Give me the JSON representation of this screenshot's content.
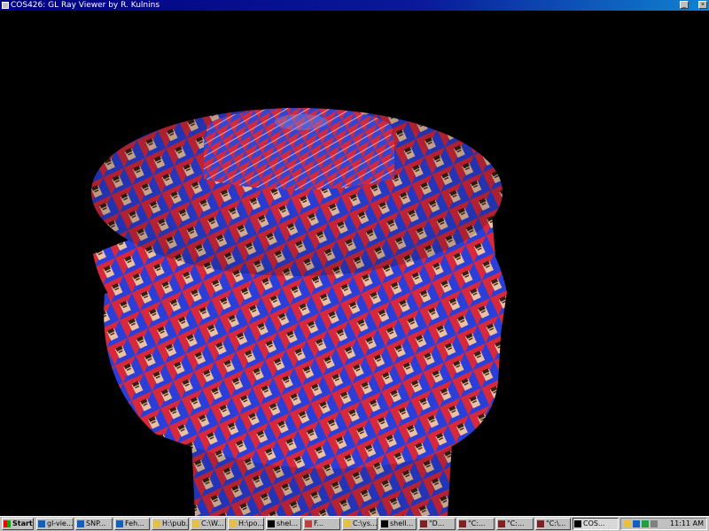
{
  "window": {
    "title": "COS426: GL Ray Viewer by R. Kulnins",
    "minimize_icon": "minimize-icon",
    "close_icon": "close-icon"
  },
  "scene": {
    "description_icon": "textured-3d-model",
    "colors": {
      "red": "#d8283c",
      "blue": "#2b3ed8",
      "background": "#000000"
    }
  },
  "taskbar": {
    "start_label": "Start",
    "buttons": [
      {
        "label": "gl-vie...",
        "icon": "window-icon"
      },
      {
        "label": "SNP...",
        "icon": "window-icon"
      },
      {
        "label": "Feh...",
        "icon": "window-icon"
      },
      {
        "label": "H:\\pub...",
        "icon": "folder-icon"
      },
      {
        "label": "C:\\W...",
        "icon": "folder-icon"
      },
      {
        "label": "H:\\po...",
        "icon": "folder-icon"
      },
      {
        "label": "shel...",
        "icon": "terminal-icon"
      },
      {
        "label": "F...",
        "icon": "app-icon"
      },
      {
        "label": "C:\\ys...",
        "icon": "folder-icon"
      },
      {
        "label": "shell...",
        "icon": "terminal-icon"
      },
      {
        "label": "\"D...",
        "icon": "app-icon"
      },
      {
        "label": "\"C:...",
        "icon": "app-icon"
      },
      {
        "label": "\"C:...",
        "icon": "app-icon"
      },
      {
        "label": "\"C:\\...",
        "icon": "app-icon"
      },
      {
        "label": "COS...",
        "icon": "app-icon",
        "active": true
      }
    ],
    "clock": "11:11 AM"
  }
}
